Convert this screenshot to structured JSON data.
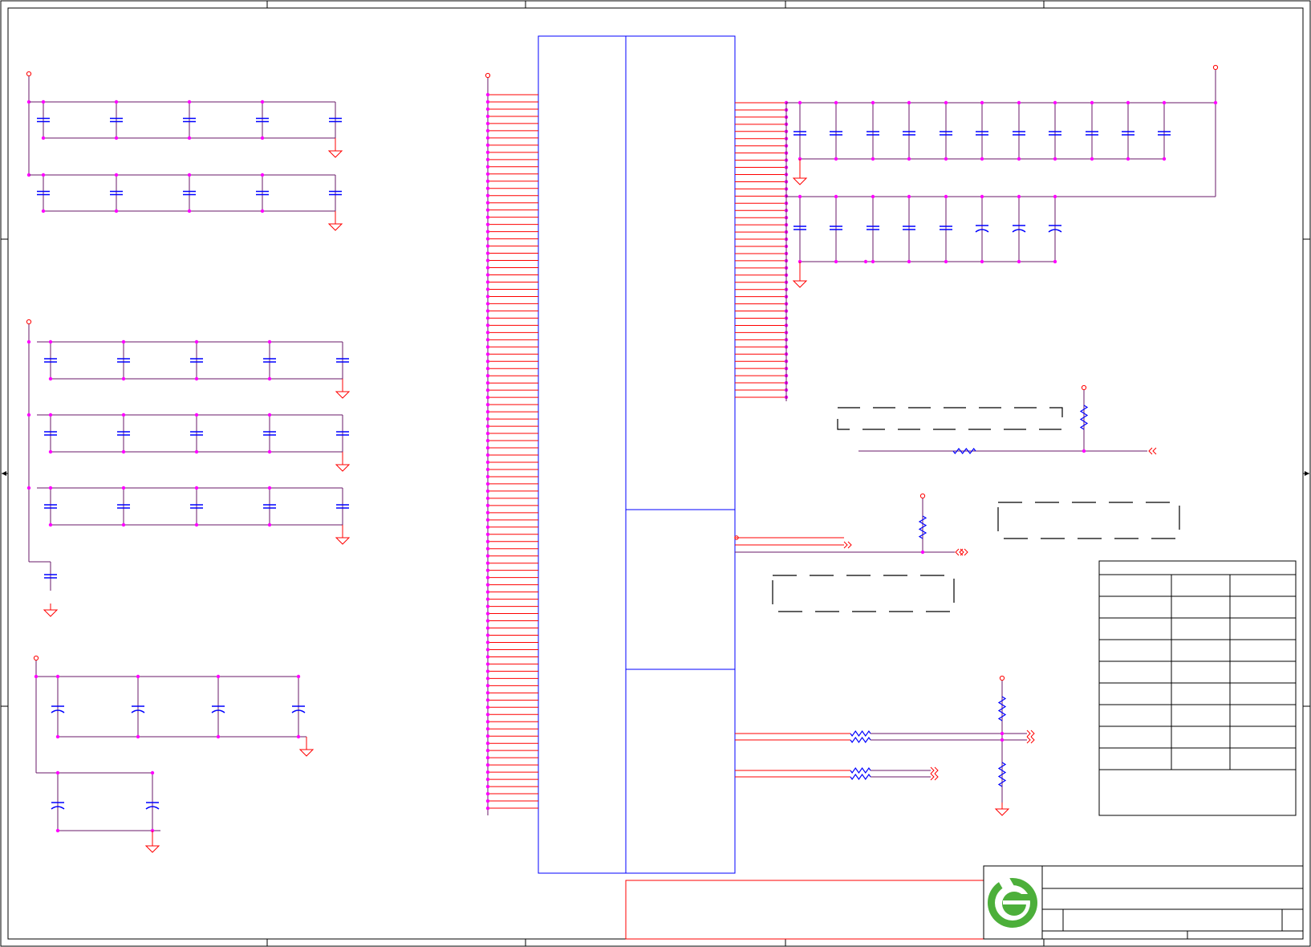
{
  "colors": {
    "frame": "#000000",
    "wire": "#6a1a6a",
    "pin": "#ff0000",
    "component": "#0000ff",
    "junction": "#ff00ff",
    "logo_green": "#4caf3a",
    "background": "#ffffff"
  },
  "title_block": {
    "logo": "company-logo-icon"
  }
}
